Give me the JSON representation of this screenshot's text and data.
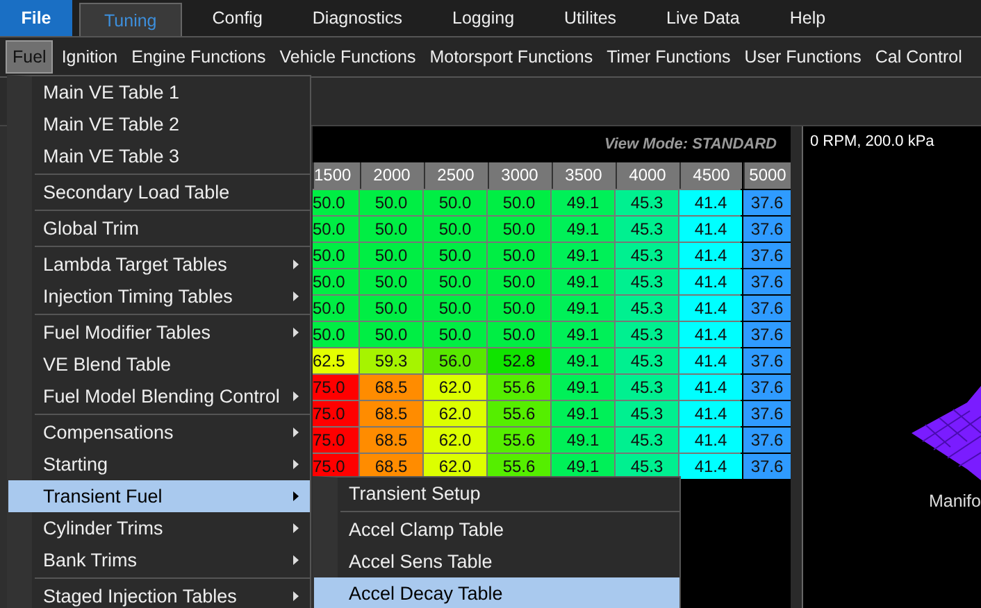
{
  "main_tabs": [
    {
      "label": "File",
      "kind": "file"
    },
    {
      "label": "Tuning",
      "kind": "tab",
      "selected": true
    },
    {
      "label": "Config",
      "kind": "tab",
      "selected": false
    },
    {
      "label": "Diagnostics",
      "kind": "tab",
      "selected": false
    },
    {
      "label": "Logging",
      "kind": "tab",
      "selected": false
    },
    {
      "label": "Utilites",
      "kind": "tab",
      "selected": false
    },
    {
      "label": "Live Data",
      "kind": "tab",
      "selected": false
    },
    {
      "label": "Help",
      "kind": "tab",
      "selected": false
    }
  ],
  "menu_bar": [
    {
      "label": "Fuel",
      "selected": true
    },
    {
      "label": "Ignition",
      "selected": false
    },
    {
      "label": "Engine Functions",
      "selected": false
    },
    {
      "label": "Vehicle Functions",
      "selected": false
    },
    {
      "label": "Motorsport Functions",
      "selected": false
    },
    {
      "label": "Timer Functions",
      "selected": false
    },
    {
      "label": "User Functions",
      "selected": false
    },
    {
      "label": "Cal Control",
      "selected": false
    }
  ],
  "fuel_menu": [
    {
      "kind": "item",
      "label": "Main VE Table 1",
      "submenu": false,
      "selected": false
    },
    {
      "kind": "item",
      "label": "Main VE Table 2",
      "submenu": false,
      "selected": false
    },
    {
      "kind": "item",
      "label": "Main VE Table 3",
      "submenu": false,
      "selected": false
    },
    {
      "kind": "separator"
    },
    {
      "kind": "item",
      "label": "Secondary Load Table",
      "submenu": false,
      "selected": false
    },
    {
      "kind": "separator"
    },
    {
      "kind": "item",
      "label": "Global Trim",
      "submenu": false,
      "selected": false
    },
    {
      "kind": "separator"
    },
    {
      "kind": "item",
      "label": "Lambda Target Tables",
      "submenu": true,
      "selected": false
    },
    {
      "kind": "item",
      "label": "Injection Timing Tables",
      "submenu": true,
      "selected": false
    },
    {
      "kind": "separator"
    },
    {
      "kind": "item",
      "label": "Fuel Modifier Tables",
      "submenu": true,
      "selected": false
    },
    {
      "kind": "item",
      "label": "VE Blend Table",
      "submenu": false,
      "selected": false
    },
    {
      "kind": "item",
      "label": "Fuel Model Blending Control",
      "submenu": true,
      "selected": false
    },
    {
      "kind": "separator"
    },
    {
      "kind": "item",
      "label": "Compensations",
      "submenu": true,
      "selected": false
    },
    {
      "kind": "item",
      "label": "Starting",
      "submenu": true,
      "selected": false
    },
    {
      "kind": "item",
      "label": "Transient Fuel",
      "submenu": true,
      "selected": true
    },
    {
      "kind": "item",
      "label": "Cylinder Trims",
      "submenu": true,
      "selected": false
    },
    {
      "kind": "item",
      "label": "Bank Trims",
      "submenu": true,
      "selected": false
    },
    {
      "kind": "separator"
    },
    {
      "kind": "item",
      "label": "Staged Injection Tables",
      "submenu": true,
      "selected": false
    }
  ],
  "transient_submenu": [
    {
      "kind": "item",
      "label": "Transient Setup",
      "selected": false
    },
    {
      "kind": "separator"
    },
    {
      "kind": "item",
      "label": "Accel Clamp Table",
      "selected": false
    },
    {
      "kind": "item",
      "label": "Accel Sens Table",
      "selected": false
    },
    {
      "kind": "item",
      "label": "Accel Decay Table",
      "selected": true
    }
  ],
  "table": {
    "view_mode": "View Mode: STANDARD",
    "columns": [
      "1500",
      "2000",
      "2500",
      "3000",
      "3500",
      "4000",
      "4500",
      "5000"
    ],
    "rows": [
      {
        "cells": [
          {
            "value": "50.0",
            "color": "#00ee44"
          },
          {
            "value": "50.0",
            "color": "#00ee44"
          },
          {
            "value": "50.0",
            "color": "#00ee44"
          },
          {
            "value": "50.0",
            "color": "#00ee44"
          },
          {
            "value": "49.1",
            "color": "#00f058"
          },
          {
            "value": "45.3",
            "color": "#00f090"
          },
          {
            "value": "41.4",
            "color": "#00ffff"
          },
          {
            "value": "37.6",
            "color": "#2f9bff"
          }
        ]
      },
      {
        "cells": [
          {
            "value": "50.0",
            "color": "#00ee44"
          },
          {
            "value": "50.0",
            "color": "#00ee44"
          },
          {
            "value": "50.0",
            "color": "#00ee44"
          },
          {
            "value": "50.0",
            "color": "#00ee44"
          },
          {
            "value": "49.1",
            "color": "#00f058"
          },
          {
            "value": "45.3",
            "color": "#00f090"
          },
          {
            "value": "41.4",
            "color": "#00ffff"
          },
          {
            "value": "37.6",
            "color": "#2f9bff"
          }
        ]
      },
      {
        "cells": [
          {
            "value": "50.0",
            "color": "#00ee44"
          },
          {
            "value": "50.0",
            "color": "#00ee44"
          },
          {
            "value": "50.0",
            "color": "#00ee44"
          },
          {
            "value": "50.0",
            "color": "#00ee44"
          },
          {
            "value": "49.1",
            "color": "#00f058"
          },
          {
            "value": "45.3",
            "color": "#00f090"
          },
          {
            "value": "41.4",
            "color": "#00ffff"
          },
          {
            "value": "37.6",
            "color": "#2f9bff"
          }
        ]
      },
      {
        "cells": [
          {
            "value": "50.0",
            "color": "#00ee44"
          },
          {
            "value": "50.0",
            "color": "#00ee44"
          },
          {
            "value": "50.0",
            "color": "#00ee44"
          },
          {
            "value": "50.0",
            "color": "#00ee44"
          },
          {
            "value": "49.1",
            "color": "#00f058"
          },
          {
            "value": "45.3",
            "color": "#00f090"
          },
          {
            "value": "41.4",
            "color": "#00ffff"
          },
          {
            "value": "37.6",
            "color": "#2f9bff"
          }
        ]
      },
      {
        "cells": [
          {
            "value": "50.0",
            "color": "#00ee44"
          },
          {
            "value": "50.0",
            "color": "#00ee44"
          },
          {
            "value": "50.0",
            "color": "#00ee44"
          },
          {
            "value": "50.0",
            "color": "#00ee44"
          },
          {
            "value": "49.1",
            "color": "#00f058"
          },
          {
            "value": "45.3",
            "color": "#00f090"
          },
          {
            "value": "41.4",
            "color": "#00ffff"
          },
          {
            "value": "37.6",
            "color": "#2f9bff"
          }
        ]
      },
      {
        "cells": [
          {
            "value": "50.0",
            "color": "#00ee44"
          },
          {
            "value": "50.0",
            "color": "#00ee44"
          },
          {
            "value": "50.0",
            "color": "#00ee44"
          },
          {
            "value": "50.0",
            "color": "#00ee44"
          },
          {
            "value": "49.1",
            "color": "#00f058"
          },
          {
            "value": "45.3",
            "color": "#00f090"
          },
          {
            "value": "41.4",
            "color": "#00ffff"
          },
          {
            "value": "37.6",
            "color": "#2f9bff"
          }
        ]
      },
      {
        "cells": [
          {
            "value": "62.5",
            "color": "#e4ff00"
          },
          {
            "value": "59.3",
            "color": "#a6f400"
          },
          {
            "value": "56.0",
            "color": "#58e800"
          },
          {
            "value": "52.8",
            "color": "#10e400"
          },
          {
            "value": "49.1",
            "color": "#00f058"
          },
          {
            "value": "45.3",
            "color": "#00f090"
          },
          {
            "value": "41.4",
            "color": "#00ffff"
          },
          {
            "value": "37.6",
            "color": "#2f9bff"
          }
        ]
      },
      {
        "cells": [
          {
            "value": "75.0",
            "color": "#ff0000"
          },
          {
            "value": "68.5",
            "color": "#ff8c00"
          },
          {
            "value": "62.0",
            "color": "#dcff00"
          },
          {
            "value": "55.6",
            "color": "#55ee00"
          },
          {
            "value": "49.1",
            "color": "#00f058"
          },
          {
            "value": "45.3",
            "color": "#00f090"
          },
          {
            "value": "41.4",
            "color": "#00ffff"
          },
          {
            "value": "37.6",
            "color": "#2f9bff"
          }
        ]
      },
      {
        "cells": [
          {
            "value": "75.0",
            "color": "#ff0000"
          },
          {
            "value": "68.5",
            "color": "#ff8c00"
          },
          {
            "value": "62.0",
            "color": "#dcff00"
          },
          {
            "value": "55.6",
            "color": "#55ee00"
          },
          {
            "value": "49.1",
            "color": "#00f058"
          },
          {
            "value": "45.3",
            "color": "#00f090"
          },
          {
            "value": "41.4",
            "color": "#00ffff"
          },
          {
            "value": "37.6",
            "color": "#2f9bff"
          }
        ]
      },
      {
        "cells": [
          {
            "value": "75.0",
            "color": "#ff0000"
          },
          {
            "value": "68.5",
            "color": "#ff8c00"
          },
          {
            "value": "62.0",
            "color": "#dcff00"
          },
          {
            "value": "55.6",
            "color": "#55ee00"
          },
          {
            "value": "49.1",
            "color": "#00f058"
          },
          {
            "value": "45.3",
            "color": "#00f090"
          },
          {
            "value": "41.4",
            "color": "#00ffff"
          },
          {
            "value": "37.6",
            "color": "#2f9bff"
          }
        ]
      },
      {
        "cells": [
          {
            "value": "75.0",
            "color": "#ff0000"
          },
          {
            "value": "68.5",
            "color": "#ff8c00"
          },
          {
            "value": "62.0",
            "color": "#dcff00"
          },
          {
            "value": "55.6",
            "color": "#55ee00"
          },
          {
            "value": "49.1",
            "color": "#00f058"
          },
          {
            "value": "45.3",
            "color": "#00f090"
          },
          {
            "value": "41.4",
            "color": "#00ffff"
          },
          {
            "value": "37.6",
            "color": "#2f9bff"
          }
        ]
      }
    ]
  },
  "graph_panel": {
    "readout": "0 RPM, 200.0 kPa",
    "axis_label": "Manifo"
  }
}
